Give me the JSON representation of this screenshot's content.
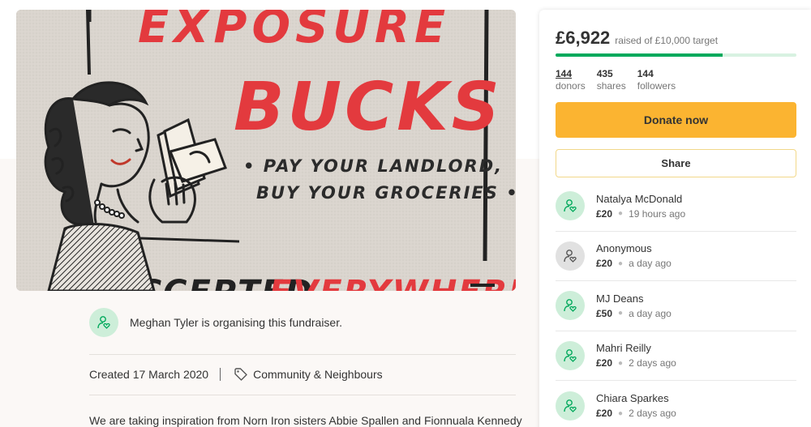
{
  "poster": {
    "line_top": "EXPOSURE",
    "line_big": "BUCKS",
    "tag_line_1": "• PAY YOUR LANDLORD,",
    "tag_line_2": "BUY YOUR GROCERIES •",
    "line_bottom_a": "ACCEPTED",
    "line_bottom_b": "EVERYWHERE!"
  },
  "organiser": {
    "text": "Meghan Tyler is organising this fundraiser."
  },
  "meta": {
    "created": "Created 17 March 2020",
    "category": "Community & Neighbours"
  },
  "story": {
    "first_line": "We are taking inspiration from Norn Iron sisters Abbie Spallen and Fionnuala Kennedy"
  },
  "campaign": {
    "raised": "£6,922",
    "target_text": "raised of £10,000 target",
    "progress": 0.6922,
    "stats": [
      {
        "num": "144",
        "label": "donors"
      },
      {
        "num": "435",
        "label": "shares"
      },
      {
        "num": "144",
        "label": "followers"
      }
    ],
    "donate_label": "Donate now",
    "share_label": "Share",
    "colors": {
      "accent_green": "#02a95c",
      "donate_yellow": "#fbb431"
    }
  },
  "donations": [
    {
      "name": "Natalya McDonald",
      "amount": "£20",
      "time": "19 hours ago",
      "avatar": "green"
    },
    {
      "name": "Anonymous",
      "amount": "£20",
      "time": "a day ago",
      "avatar": "grey"
    },
    {
      "name": "MJ Deans",
      "amount": "£50",
      "time": "a day ago",
      "avatar": "green"
    },
    {
      "name": "Mahri Reilly",
      "amount": "£20",
      "time": "2 days ago",
      "avatar": "green"
    },
    {
      "name": "Chiara Sparkes",
      "amount": "£20",
      "time": "2 days ago",
      "avatar": "green"
    }
  ]
}
